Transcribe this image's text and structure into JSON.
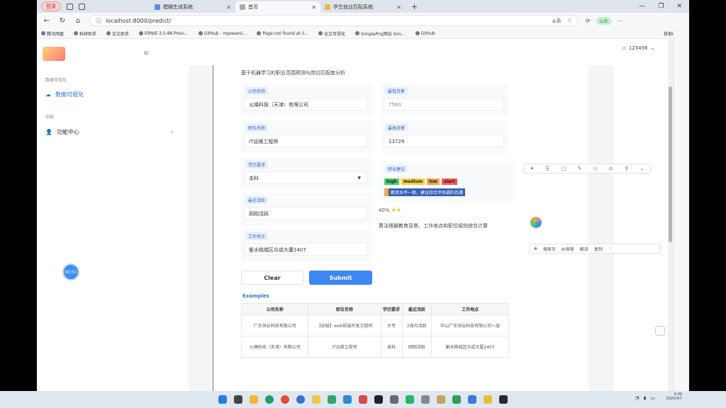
{
  "browser": {
    "sys_pill": "登录",
    "tabs": [
      {
        "label": "模糊生成系统",
        "active": false
      },
      {
        "label": "首页",
        "active": true
      },
      {
        "label": "学生就业匹配系统",
        "active": false
      }
    ],
    "url": "localhost:8000/predict/",
    "profile_badge": "山东"
  },
  "bookmarks": [
    "腾讯网盘",
    "科研助手",
    "论文助手",
    "ERNIE-3.5-8K-Previ...",
    "GitHub - mpoeani/...",
    "Page not found at /i...",
    "论文可视化",
    "SimpleProj网站 Sim...",
    "Github"
  ],
  "bookmarks_right": "其他收藏夹",
  "sidebar": {
    "section1": "数据可视化",
    "item1": "数据可视化",
    "section2": "功能",
    "item2": "功能中心",
    "timer": "00:51"
  },
  "user": {
    "name": "123456"
  },
  "form": {
    "title": "基于机器学习的职业范围预测与岗位匹配度分析",
    "company_label": "公司名称",
    "company_value": "火绳科技（天津）有限公司",
    "position_label": "职位名称",
    "position_value": "IT运维工程师",
    "education_label": "学历要求",
    "education_value": "本科",
    "activity_label": "最近活跃",
    "activity_value": "刚刚活跃",
    "location_label": "工作地点",
    "location_value": "衡水桃城区众成大厦2407",
    "clear": "Clear",
    "submit": "Submit"
  },
  "result": {
    "min_label": "最低月薪",
    "min_value": "7583",
    "max_label": "最高月薪",
    "max_value": "13729",
    "advice_label": "职业建议",
    "tags": [
      "high",
      "medium",
      "low",
      "alert"
    ],
    "highlight": "薪资水平一般，建议综合评估福利待遇",
    "percent": "40%",
    "desc": "算法根据教育背景、工作地点和职位级别综合计算"
  },
  "examples": {
    "title": "Examples",
    "headers": [
      "公司名称",
      "职位名称",
      "学历要求",
      "最近活跃",
      "工作地点"
    ],
    "rows": [
      [
        "广东领云科技有限公司",
        "【初级】web前端开发工程师",
        "大专",
        "2周内活跃",
        "中山广东领云科技有限公司一层"
      ],
      [
        "火绳科技（天津）有限公司",
        "IT运维工程师",
        "本科",
        "刚刚活跃",
        "衡水桃城区众成大厦2407"
      ]
    ]
  },
  "popup": {
    "a": "搜索页",
    "b": "AI搜索",
    "c": "翻译",
    "d": "复制"
  },
  "clock": {
    "time": "0:30",
    "date": "2025/4/7"
  }
}
